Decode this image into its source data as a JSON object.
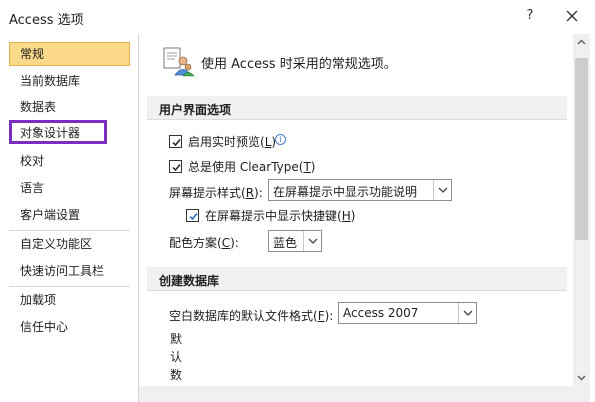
{
  "window": {
    "title": "Access 选项",
    "help_label": "?"
  },
  "sidebar": {
    "items": [
      {
        "label": "常规"
      },
      {
        "label": "当前数据库"
      },
      {
        "label": "数据表"
      },
      {
        "label": "对象设计器"
      },
      {
        "label": "校对"
      },
      {
        "label": "语言"
      },
      {
        "label": "客户端设置"
      },
      {
        "label": "自定义功能区"
      },
      {
        "label": "快速访问工具栏"
      },
      {
        "label": "加载项"
      },
      {
        "label": "信任中心"
      }
    ],
    "selected_index": 0,
    "highlighted_index": 3
  },
  "main": {
    "header_text": "使用 Access 时采用的常规选项。",
    "ui_section": {
      "title": "用户界面选项",
      "live_preview": {
        "label": "启用实时预览(",
        "key": "L",
        "suffix": ")",
        "checked": true,
        "info_icon": "info-icon"
      },
      "cleartype": {
        "label": "总是使用 ClearType(",
        "key": "T",
        "suffix": ")",
        "checked": true
      },
      "screentip_style": {
        "label": "屏幕提示样式(",
        "key": "R",
        "suffix": "):",
        "value": "在屏幕提示中显示功能说明"
      },
      "show_shortcuts": {
        "label": "在屏幕提示中显示快捷键(",
        "key": "H",
        "suffix": ")",
        "checked": true
      },
      "color_scheme": {
        "label": "配色方案(",
        "key": "C",
        "suffix": "):",
        "value": "蓝色"
      }
    },
    "db_section": {
      "title": "创建数据库",
      "default_format": {
        "label": "空白数据库的默认文件格式(",
        "key": "F",
        "suffix": "):",
        "value": "Access 2007"
      },
      "default_folder_chars": [
        "默",
        "认",
        "数"
      ]
    }
  },
  "colors": {
    "selected_bg": "#fbd98b",
    "highlight_border": "#7b2fbe",
    "section_bg": "#f0f0f0"
  }
}
